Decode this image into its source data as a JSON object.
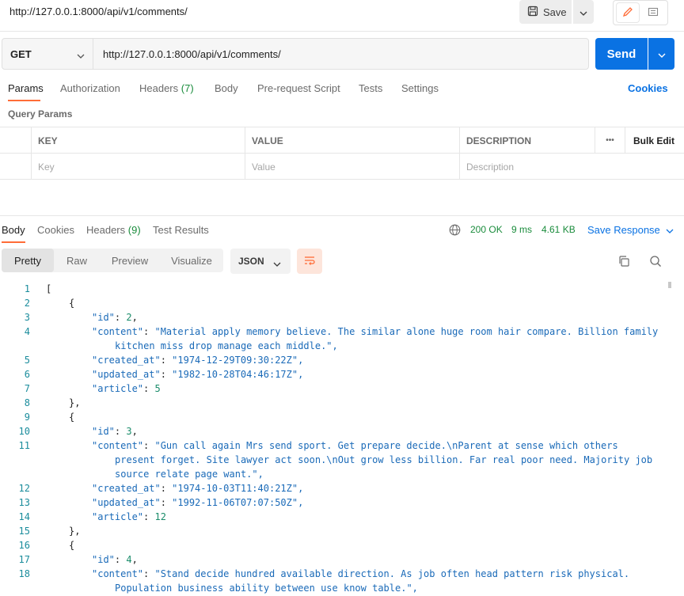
{
  "request": {
    "title": "http://127.0.0.1:8000/api/v1/comments/",
    "method": "GET",
    "url": "http://127.0.0.1:8000/api/v1/comments/",
    "save_label": "Save",
    "send_label": "Send"
  },
  "req_tabs": {
    "params": "Params",
    "authorization": "Authorization",
    "headers": "Headers",
    "headers_count": "(7)",
    "body": "Body",
    "prerequest": "Pre-request Script",
    "tests": "Tests",
    "settings": "Settings",
    "cookies": "Cookies"
  },
  "params": {
    "section_label": "Query Params",
    "columns": {
      "key": "KEY",
      "value": "VALUE",
      "description": "DESCRIPTION",
      "more": "•••",
      "bulk_edit": "Bulk Edit"
    },
    "placeholders": {
      "key": "Key",
      "value": "Value",
      "description": "Description"
    }
  },
  "response": {
    "tabs": {
      "body": "Body",
      "cookies": "Cookies",
      "headers": "Headers",
      "headers_count": "(9)",
      "tests": "Test Results"
    },
    "status": "200 OK",
    "time": "9 ms",
    "size": "4.61 KB",
    "save_response": "Save Response",
    "views": {
      "pretty": "Pretty",
      "raw": "Raw",
      "preview": "Preview",
      "visualize": "Visualize"
    },
    "format": "JSON"
  },
  "code_lines": [
    {
      "n": "1",
      "indent": 0,
      "html": "["
    },
    {
      "n": "2",
      "indent": 1,
      "html": "{"
    },
    {
      "n": "3",
      "indent": 2,
      "key": "id",
      "num": "2"
    },
    {
      "n": "4",
      "indent": 2,
      "key": "content",
      "str": "\"Material apply memory believe. The similar alone huge room hair compare. Billion family"
    },
    {
      "n": "",
      "indent": 3,
      "cont": "kitchen miss drop manage each middle.\","
    },
    {
      "n": "5",
      "indent": 2,
      "key": "created_at",
      "str": "\"1974-12-29T09:30:22Z\","
    },
    {
      "n": "6",
      "indent": 2,
      "key": "updated_at",
      "str": "\"1982-10-28T04:46:17Z\","
    },
    {
      "n": "7",
      "indent": 2,
      "key": "article",
      "num_last": "5"
    },
    {
      "n": "8",
      "indent": 1,
      "html": "},"
    },
    {
      "n": "9",
      "indent": 1,
      "html": "{"
    },
    {
      "n": "10",
      "indent": 2,
      "key": "id",
      "num": "3"
    },
    {
      "n": "11",
      "indent": 2,
      "key": "content",
      "str": "\"Gun call again Mrs send sport. Get prepare decide.\\nParent at sense which others"
    },
    {
      "n": "",
      "indent": 3,
      "cont": "present forget. Site lawyer act soon.\\nOut grow less billion. Far real poor need. Majority job"
    },
    {
      "n": "",
      "indent": 3,
      "cont": "source relate page want.\","
    },
    {
      "n": "12",
      "indent": 2,
      "key": "created_at",
      "str": "\"1974-10-03T11:40:21Z\","
    },
    {
      "n": "13",
      "indent": 2,
      "key": "updated_at",
      "str": "\"1992-11-06T07:07:50Z\","
    },
    {
      "n": "14",
      "indent": 2,
      "key": "article",
      "num_last": "12"
    },
    {
      "n": "15",
      "indent": 1,
      "html": "},"
    },
    {
      "n": "16",
      "indent": 1,
      "html": "{"
    },
    {
      "n": "17",
      "indent": 2,
      "key": "id",
      "num": "4"
    },
    {
      "n": "18",
      "indent": 2,
      "key": "content",
      "str": "\"Stand decide hundred available direction. As job often head pattern risk physical."
    },
    {
      "n": "",
      "indent": 3,
      "cont": "Population business ability between use know table.\","
    }
  ]
}
